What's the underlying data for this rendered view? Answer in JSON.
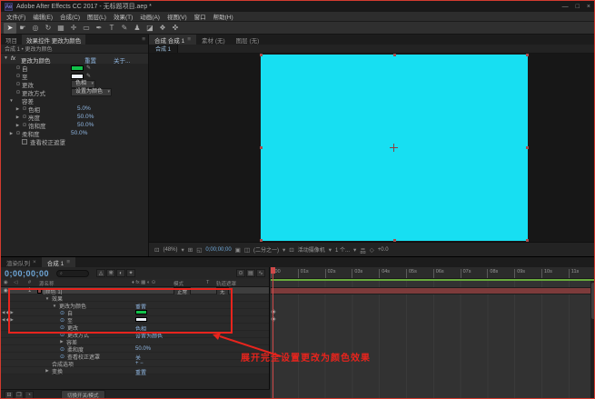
{
  "colors": {
    "comp_cyan": "#17dff2",
    "cache_green": "#67a93c",
    "layer_band": "#7d3b3b",
    "value_blue": "#8fb6e1",
    "timecode_blue": "#6ea7d8"
  },
  "titlebar": {
    "icon_text": "Ae",
    "title": "Adobe After Effects CC 2017 - 无标题项目.aep *",
    "min": "—",
    "max": "□",
    "close": "×"
  },
  "menubar": {
    "items": [
      "文件(F)",
      "编辑(E)",
      "合成(C)",
      "图层(L)",
      "效果(T)",
      "动画(A)",
      "视图(V)",
      "窗口",
      "帮助(H)"
    ]
  },
  "toolbar": {
    "tools": [
      {
        "name": "selection-tool",
        "glyph": "➤"
      },
      {
        "name": "hand-tool",
        "glyph": "☛"
      },
      {
        "name": "zoom-tool",
        "glyph": "◎"
      },
      {
        "name": "rotate-tool",
        "glyph": "↻"
      },
      {
        "name": "camera-tool",
        "glyph": "▦"
      },
      {
        "name": "pan-behind-tool",
        "glyph": "✛"
      },
      {
        "name": "shape-tool",
        "glyph": "▭"
      },
      {
        "name": "pen-tool",
        "glyph": "✒"
      },
      {
        "name": "type-tool",
        "glyph": "T"
      },
      {
        "name": "brush-tool",
        "glyph": "✎"
      },
      {
        "name": "clone-stamp-tool",
        "glyph": "♟"
      },
      {
        "name": "eraser-tool",
        "glyph": "◪"
      },
      {
        "name": "roto-brush-tool",
        "glyph": "❖"
      },
      {
        "name": "puppet-pin-tool",
        "glyph": "✜"
      }
    ]
  },
  "effect_panel": {
    "tab_project": "项目",
    "tab_effects": "效果控件 更改为颜色",
    "panel_menu": "≡",
    "breadcrumb": "合成 1 • 更改为颜色",
    "header_twirl": "▼",
    "fx_badge": "fx",
    "effect_name": "更改为颜色",
    "reset": "重置",
    "about": "关于...",
    "rows": [
      {
        "label": "自",
        "type": "swatch",
        "swatch": "#12c14a"
      },
      {
        "label": "至",
        "type": "swatch",
        "swatch": "#eaeef6"
      },
      {
        "label": "更改",
        "type": "dropdown",
        "value": "色相"
      },
      {
        "label": "更改方式",
        "type": "dropdown",
        "value": "设置为颜色"
      },
      {
        "label": "容差",
        "type": "group",
        "twirl": "▼"
      },
      {
        "label": "色相",
        "type": "value",
        "value": "5.0%",
        "indent": 1,
        "twirl": "▶"
      },
      {
        "label": "亮度",
        "type": "value",
        "value": "50.0%",
        "indent": 1,
        "twirl": "▶"
      },
      {
        "label": "饱和度",
        "type": "value",
        "value": "50.0%",
        "indent": 1,
        "twirl": "▶"
      },
      {
        "label": "柔和度",
        "type": "value",
        "value": "50.0%",
        "twirl": "▶"
      },
      {
        "label": "查看校正遮罩",
        "type": "checkbox"
      }
    ]
  },
  "viewer": {
    "tab_comp": "合成 合成 1",
    "panel_menu": "≡",
    "tab_footage": "素材 (无)",
    "tab_layer": "图层 (无)",
    "subtab": "合成 1",
    "statusbar": [
      {
        "kind": "icon",
        "glyph": "⊡",
        "name": "always-preview-icon"
      },
      {
        "kind": "text",
        "value": "(48%)",
        "name": "magnification-value"
      },
      {
        "kind": "icon",
        "glyph": "▾",
        "name": "magnification-dropdown-icon"
      },
      {
        "kind": "icon",
        "glyph": "⊞",
        "name": "grid-guides-icon"
      },
      {
        "kind": "icon",
        "glyph": "◱",
        "name": "mask-visibility-icon"
      },
      {
        "kind": "time",
        "value": "0;00;00;00",
        "name": "preview-timecode"
      },
      {
        "kind": "icon",
        "glyph": "▣",
        "name": "snapshot-icon"
      },
      {
        "kind": "icon",
        "glyph": "◫",
        "name": "show-snapshot-icon"
      },
      {
        "kind": "text",
        "value": "(二分之一)",
        "name": "resolution-value"
      },
      {
        "kind": "icon",
        "glyph": "▾",
        "name": "resolution-dropdown-icon"
      },
      {
        "kind": "icon",
        "glyph": "⊡",
        "name": "roi-icon"
      },
      {
        "kind": "text",
        "value": "活动摄像机",
        "name": "camera-view-value"
      },
      {
        "kind": "icon",
        "glyph": "▾",
        "name": "camera-dropdown-icon"
      },
      {
        "kind": "text",
        "value": "1 个...",
        "name": "view-layout-value"
      },
      {
        "kind": "icon",
        "glyph": "▾",
        "name": "view-layout-dropdown-icon"
      },
      {
        "kind": "icon",
        "glyph": "品",
        "name": "pixel-aspect-icon"
      },
      {
        "kind": "icon",
        "glyph": "◇",
        "name": "exposure-icon"
      },
      {
        "kind": "text",
        "value": "+0.0",
        "name": "exposure-value"
      }
    ]
  },
  "timeline": {
    "tab_queue": "渲染队列",
    "tab_comp": "合成 1",
    "close": "×",
    "panel_menu": "≡",
    "timecode": "0;00;00;00",
    "search_icon": "⌕",
    "topbar_icons_mid": [
      {
        "glyph": "◬",
        "name": "draft-3d-icon"
      },
      {
        "glyph": "❋",
        "name": "hide-shy-layers-icon"
      },
      {
        "glyph": "◐",
        "name": "frame-blending-icon"
      },
      {
        "glyph": "✦",
        "name": "motion-blur-icon"
      }
    ],
    "topbar_icons_right": [
      {
        "glyph": "⊙",
        "name": "live-update-icon"
      },
      {
        "glyph": "▤",
        "name": "layer-switches-icon"
      },
      {
        "glyph": "∿",
        "name": "graph-editor-icon"
      }
    ],
    "header": {
      "eye": "◉",
      "audio": "◁",
      "num": "#",
      "name": "源名称",
      "switches": "♦ fx ▦ ◐ ⊙",
      "mode": "模式",
      "t": "T",
      "matte": "轨道遮罩"
    },
    "rows": [
      {
        "eye": "◉",
        "num": "1",
        "chip": "#8a4444",
        "label": "[颜色 1]",
        "mode": "正常",
        "matte": "无",
        "selected": true
      },
      {
        "twirl": "▼",
        "indent": 1,
        "label": "效果"
      },
      {
        "twirl": "▼",
        "indent": 2,
        "label": "更改为颜色",
        "right": "重置"
      },
      {
        "indent": 3,
        "label": "自",
        "swatch": "#12c14a",
        "stopwatch": true,
        "keynav": "◀ ◆ ▶"
      },
      {
        "indent": 3,
        "label": "至",
        "swatch": "#eaeef6",
        "stopwatch": true,
        "keynav": "◀ ◆ ▶"
      },
      {
        "indent": 3,
        "label": "更改",
        "value": "色相",
        "stopwatch": true
      },
      {
        "indent": 3,
        "label": "更改方式",
        "value": "设置为颜色",
        "stopwatch": true
      },
      {
        "twirl": "▶",
        "indent": 3,
        "label": "容差"
      },
      {
        "indent": 3,
        "label": "柔和度",
        "value": "50.0%",
        "stopwatch": true
      },
      {
        "indent": 3,
        "label": "查看校正遮罩",
        "value": "关",
        "stopwatch": true
      },
      {
        "indent": 2,
        "label": "合成选项",
        "right": "+ −"
      },
      {
        "twirl": "▶",
        "indent": 1,
        "label": "变换",
        "right": "重置"
      }
    ],
    "ruler_ticks": [
      ":00",
      "01s",
      "02s",
      "03s",
      "04s",
      "05s",
      "06s",
      "07s",
      "08s",
      "09s",
      "10s",
      "11s"
    ],
    "bottom_icons": [
      {
        "glyph": "⊟",
        "name": "expand-layer-switches-icon"
      },
      {
        "glyph": "❐",
        "name": "expand-transfer-controls-icon"
      },
      {
        "glyph": "◔",
        "name": "expand-inout-icon"
      }
    ],
    "bottom_toggle": "切换开关/模式"
  },
  "annotation": {
    "text": "展开完全设置更改为颜色效果",
    "color": "#e8241d"
  }
}
